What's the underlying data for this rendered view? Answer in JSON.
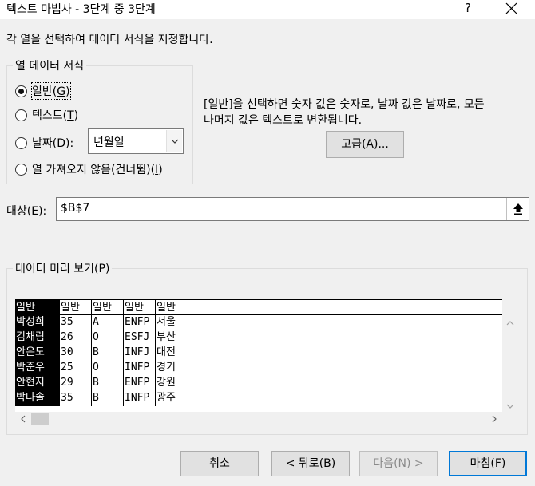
{
  "window": {
    "title": "텍스트 마법사 - 3단계 중 3단계",
    "help": "?"
  },
  "instruction": "각 열을 선택하여 데이터 서식을 지정합니다.",
  "format_group": {
    "legend": "열 데이터 서식",
    "options": [
      {
        "label": "일반",
        "key": "G",
        "checked": true
      },
      {
        "label": "텍스트",
        "key": "T",
        "checked": false
      },
      {
        "label": "날짜",
        "key": "D",
        "checked": false
      },
      {
        "label": "열 가져오지 않음(건너뜀)",
        "key": "I",
        "checked": false
      }
    ],
    "date_format": "년월일"
  },
  "description": {
    "line1": "[일반]을 선택하면 숫자 값은 숫자로, 날짜 값은 날짜로, 모든",
    "line2": "나머지 값은 텍스트로 변환됩니다."
  },
  "advanced_button": "고급(A)...",
  "target": {
    "label": "대상(E):",
    "value": "$B$7"
  },
  "preview": {
    "legend": "데이터 미리 보기(P)",
    "headers": [
      "일반",
      "일반",
      "일반",
      "일반",
      "일반"
    ],
    "rows": [
      [
        "박성희",
        "35",
        "A",
        "ENFP",
        "서울"
      ],
      [
        "김채림",
        "26",
        "O",
        "ESFJ",
        "부산"
      ],
      [
        "안은도",
        "30",
        "B",
        "INFJ",
        "대전"
      ],
      [
        "박준우",
        "25",
        "O",
        "INFP",
        "경기"
      ],
      [
        "안현지",
        "29",
        "B",
        "ENFP",
        "강원"
      ],
      [
        "박다솔",
        "35",
        "B",
        "INFP",
        "광주"
      ]
    ]
  },
  "buttons": {
    "cancel": "취소",
    "back": "< 뒤로(B)",
    "next": "다음(N) >",
    "finish": "마침(F)"
  }
}
